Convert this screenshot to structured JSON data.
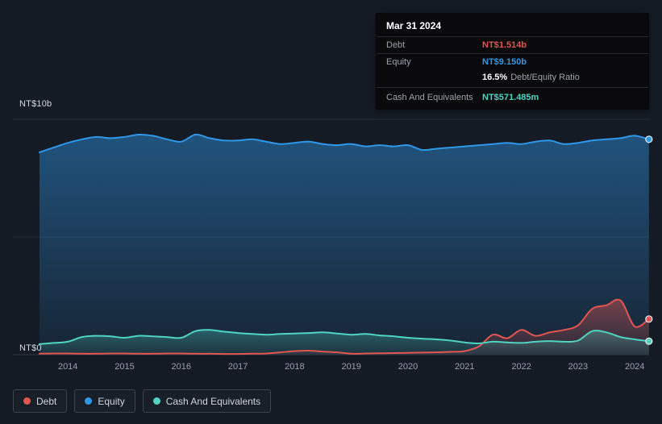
{
  "colors": {
    "background": "#151b25",
    "debt": "#e25550",
    "equity": "#2f97e8",
    "cash": "#4fd4c2",
    "grid": "#242e3b",
    "baseline": "#2e3844"
  },
  "tooltip": {
    "date": "Mar 31 2024",
    "debt_label": "Debt",
    "debt_value": "NT$1.514b",
    "equity_label": "Equity",
    "equity_value": "NT$9.150b",
    "ratio_value": "16.5%",
    "ratio_label": "Debt/Equity Ratio",
    "cash_label": "Cash And Equivalents",
    "cash_value": "NT$571.485m"
  },
  "axis": {
    "y_top": "NT$10b",
    "y_bottom": "NT$0"
  },
  "legend": {
    "debt": "Debt",
    "equity": "Equity",
    "cash": "Cash And Equivalents"
  },
  "chart_data": {
    "type": "area",
    "x_unit": "year",
    "ylim": [
      0,
      10
    ],
    "x_ticks": [
      2014,
      2015,
      2016,
      2017,
      2018,
      2019,
      2020,
      2021,
      2022,
      2023,
      2024
    ],
    "x": [
      2013.5,
      2013.75,
      2014.0,
      2014.25,
      2014.5,
      2014.75,
      2015.0,
      2015.25,
      2015.5,
      2015.75,
      2016.0,
      2016.25,
      2016.5,
      2016.75,
      2017.0,
      2017.25,
      2017.5,
      2017.75,
      2018.0,
      2018.25,
      2018.5,
      2018.75,
      2019.0,
      2019.25,
      2019.5,
      2019.75,
      2020.0,
      2020.25,
      2020.5,
      2020.75,
      2021.0,
      2021.25,
      2021.5,
      2021.75,
      2022.0,
      2022.25,
      2022.5,
      2022.75,
      2023.0,
      2023.25,
      2023.5,
      2023.75,
      2024.0,
      2024.25
    ],
    "series": [
      {
        "name": "Equity",
        "color": "#2f97e8",
        "values": [
          8.6,
          8.8,
          9.0,
          9.15,
          9.25,
          9.2,
          9.25,
          9.35,
          9.3,
          9.15,
          9.05,
          9.35,
          9.2,
          9.1,
          9.1,
          9.15,
          9.05,
          8.95,
          9.0,
          9.05,
          8.95,
          8.9,
          8.95,
          8.85,
          8.9,
          8.85,
          8.9,
          8.7,
          8.75,
          8.8,
          8.85,
          8.9,
          8.95,
          9.0,
          8.95,
          9.05,
          9.1,
          8.95,
          9.0,
          9.1,
          9.15,
          9.2,
          9.3,
          9.15
        ]
      },
      {
        "name": "Debt",
        "color": "#e25550",
        "values": [
          0.04,
          0.05,
          0.05,
          0.04,
          0.04,
          0.05,
          0.05,
          0.04,
          0.04,
          0.05,
          0.05,
          0.04,
          0.04,
          0.03,
          0.03,
          0.04,
          0.05,
          0.1,
          0.15,
          0.17,
          0.13,
          0.1,
          0.04,
          0.05,
          0.06,
          0.07,
          0.08,
          0.09,
          0.1,
          0.12,
          0.15,
          0.35,
          0.85,
          0.7,
          1.05,
          0.8,
          0.95,
          1.05,
          1.25,
          1.95,
          2.1,
          2.3,
          1.2,
          1.514
        ]
      },
      {
        "name": "Cash And Equivalents",
        "color": "#4fd4c2",
        "values": [
          0.45,
          0.5,
          0.55,
          0.75,
          0.8,
          0.78,
          0.72,
          0.8,
          0.78,
          0.75,
          0.72,
          1.0,
          1.05,
          0.98,
          0.92,
          0.88,
          0.85,
          0.88,
          0.9,
          0.92,
          0.95,
          0.9,
          0.85,
          0.88,
          0.82,
          0.78,
          0.72,
          0.68,
          0.65,
          0.6,
          0.52,
          0.48,
          0.55,
          0.52,
          0.5,
          0.55,
          0.58,
          0.55,
          0.6,
          1.0,
          0.95,
          0.75,
          0.65,
          0.571
        ]
      }
    ]
  }
}
